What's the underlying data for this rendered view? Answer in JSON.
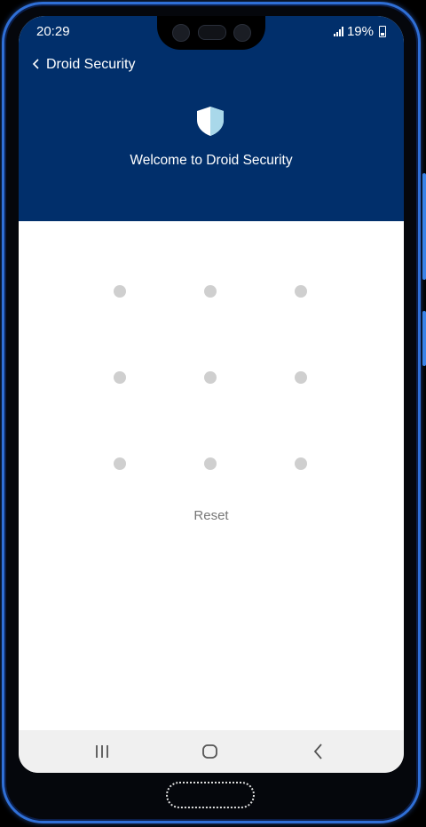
{
  "status_bar": {
    "time": "20:29",
    "battery": "19%"
  },
  "toolbar": {
    "back_icon": "chevron-left-icon",
    "title": "Droid Security"
  },
  "header": {
    "icon": "shield-icon",
    "welcome_text": "Welcome to Droid Security",
    "background_color": "#012f6b"
  },
  "pattern": {
    "dot_color": "#cfcfcf"
  },
  "reset_label": "Reset",
  "nav_bar": {
    "recent_icon": "recent-apps-icon",
    "home_icon": "home-icon",
    "back_icon": "back-icon"
  },
  "accent_color": "#2f6fd6"
}
